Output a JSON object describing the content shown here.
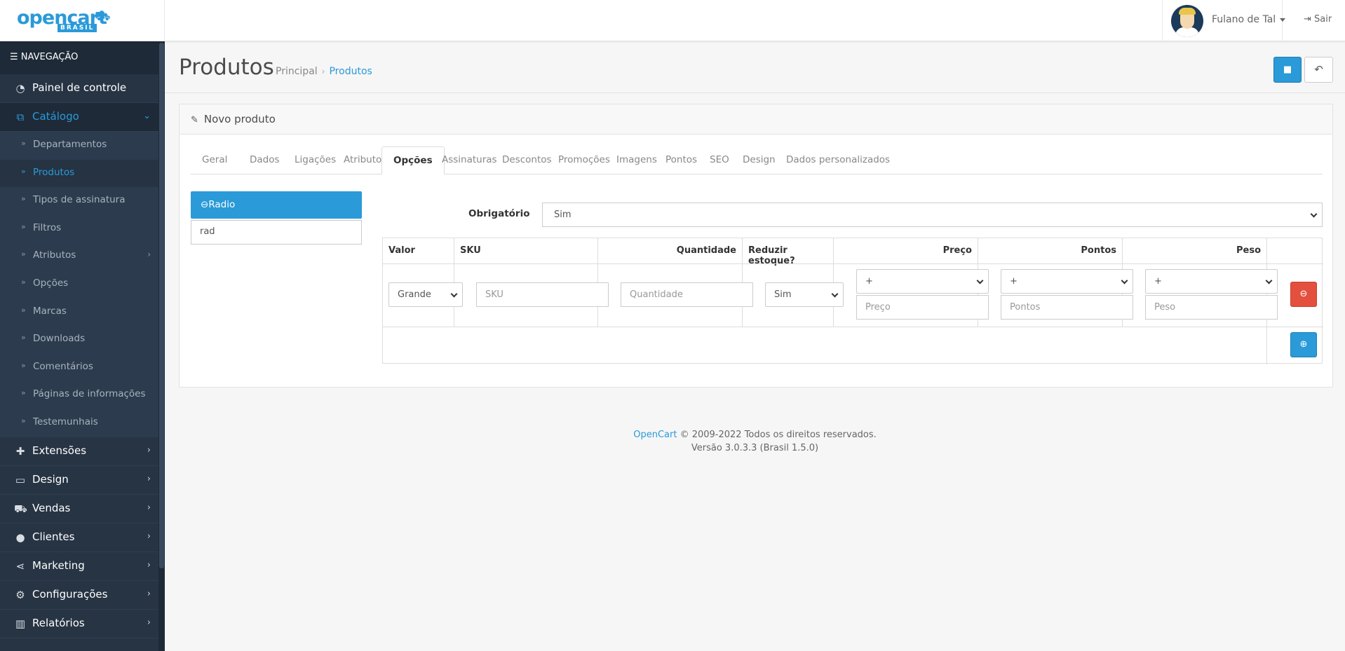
{
  "header": {
    "logo_main": "opencart",
    "logo_sub": "BRASIL",
    "user_name": "Fulano de Tal",
    "logout_label": "Sair"
  },
  "sidebar": {
    "heading": "NAVEGAÇÃO",
    "items": [
      {
        "label": "Painel de controle",
        "icon": "dashboard-icon"
      },
      {
        "label": "Catálogo",
        "icon": "tags-icon",
        "active": true
      },
      {
        "label": "Extensões",
        "icon": "puzzle-icon"
      },
      {
        "label": "Design",
        "icon": "monitor-icon"
      },
      {
        "label": "Vendas",
        "icon": "cart-icon"
      },
      {
        "label": "Clientes",
        "icon": "user-icon"
      },
      {
        "label": "Marketing",
        "icon": "share-icon"
      },
      {
        "label": "Configurações",
        "icon": "gear-icon"
      },
      {
        "label": "Relatórios",
        "icon": "bar-chart-icon"
      }
    ],
    "catalog_sub": [
      "Departamentos",
      "Produtos",
      "Tipos de assinatura",
      "Filtros",
      "Atributos",
      "Opções",
      "Marcas",
      "Downloads",
      "Comentários",
      "Páginas de informações",
      "Testemunhais"
    ]
  },
  "page": {
    "title": "Produtos",
    "breadcrumb": [
      "Principal",
      "Produtos"
    ]
  },
  "panel": {
    "heading": "Novo produto",
    "tabs": [
      "Geral",
      "Dados",
      "Ligações",
      "Atributos",
      "Opções",
      "Assinaturas",
      "Descontos",
      "Promoções",
      "Imagens",
      "Pontos",
      "SEO",
      "Design",
      "Dados personalizados"
    ],
    "active_tab": "Opções"
  },
  "options": {
    "active_option": "Radio",
    "autocomplete_value": "rad",
    "required_label": "Obrigatório",
    "required_value": "Sim",
    "columns": [
      "Valor",
      "SKU",
      "Quantidade",
      "Reduzir estoque?",
      "Preço",
      "Pontos",
      "Peso"
    ],
    "row": {
      "valor": "Grande",
      "sku_placeholder": "SKU",
      "quantidade_placeholder": "Quantidade",
      "reduzir": "Sim",
      "preco_prefix": "+",
      "preco_placeholder": "Preço",
      "pontos_prefix": "+",
      "pontos_placeholder": "Pontos",
      "peso_prefix": "+",
      "peso_placeholder": "Peso"
    }
  },
  "footer": {
    "link": "OpenCart",
    "copyright": " © 2009-2022 Todos os direitos reservados.",
    "version": "Versão 3.0.3.3 (Brasil 1.5.0)"
  },
  "colors": {
    "accent": "#2a9ad8",
    "danger": "#e3503e",
    "sidebar_bg": "#273444"
  }
}
